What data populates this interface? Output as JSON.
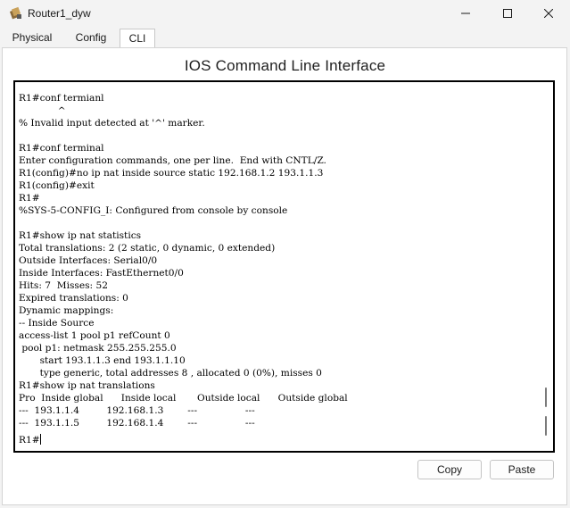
{
  "window": {
    "title": "Router1_dyw"
  },
  "tabs": [
    {
      "label": "Physical"
    },
    {
      "label": "Config"
    },
    {
      "label": "CLI"
    }
  ],
  "panel": {
    "title": "IOS Command Line Interface"
  },
  "terminal": {
    "lines": [
      "R1#conf termianl",
      "             ^",
      "% Invalid input detected at '^' marker.",
      "",
      "R1#conf terminal",
      "Enter configuration commands, one per line.  End with CNTL/Z.",
      "R1(config)#no ip nat inside source static 192.168.1.2 193.1.1.3",
      "R1(config)#exit",
      "R1#",
      "%SYS-5-CONFIG_I: Configured from console by console",
      "",
      "R1#show ip nat statistics",
      "Total translations: 2 (2 static, 0 dynamic, 0 extended)",
      "Outside Interfaces: Serial0/0",
      "Inside Interfaces: FastEthernet0/0",
      "Hits: 7  Misses: 52",
      "Expired translations: 0",
      "Dynamic mappings:",
      "-- Inside Source",
      "access-list 1 pool p1 refCount 0",
      " pool p1: netmask 255.255.255.0",
      "       start 193.1.1.3 end 193.1.1.10",
      "       type generic, total addresses 8 , allocated 0 (0%), misses 0",
      "R1#show ip nat translations",
      "Pro  Inside global      Inside local       Outside local      Outside global",
      "---  193.1.1.4         192.168.1.3        ---                ---",
      "---  193.1.1.5         192.168.1.4        ---                ---"
    ],
    "prompt": "R1#"
  },
  "buttons": {
    "copy": "Copy",
    "paste": "Paste"
  }
}
